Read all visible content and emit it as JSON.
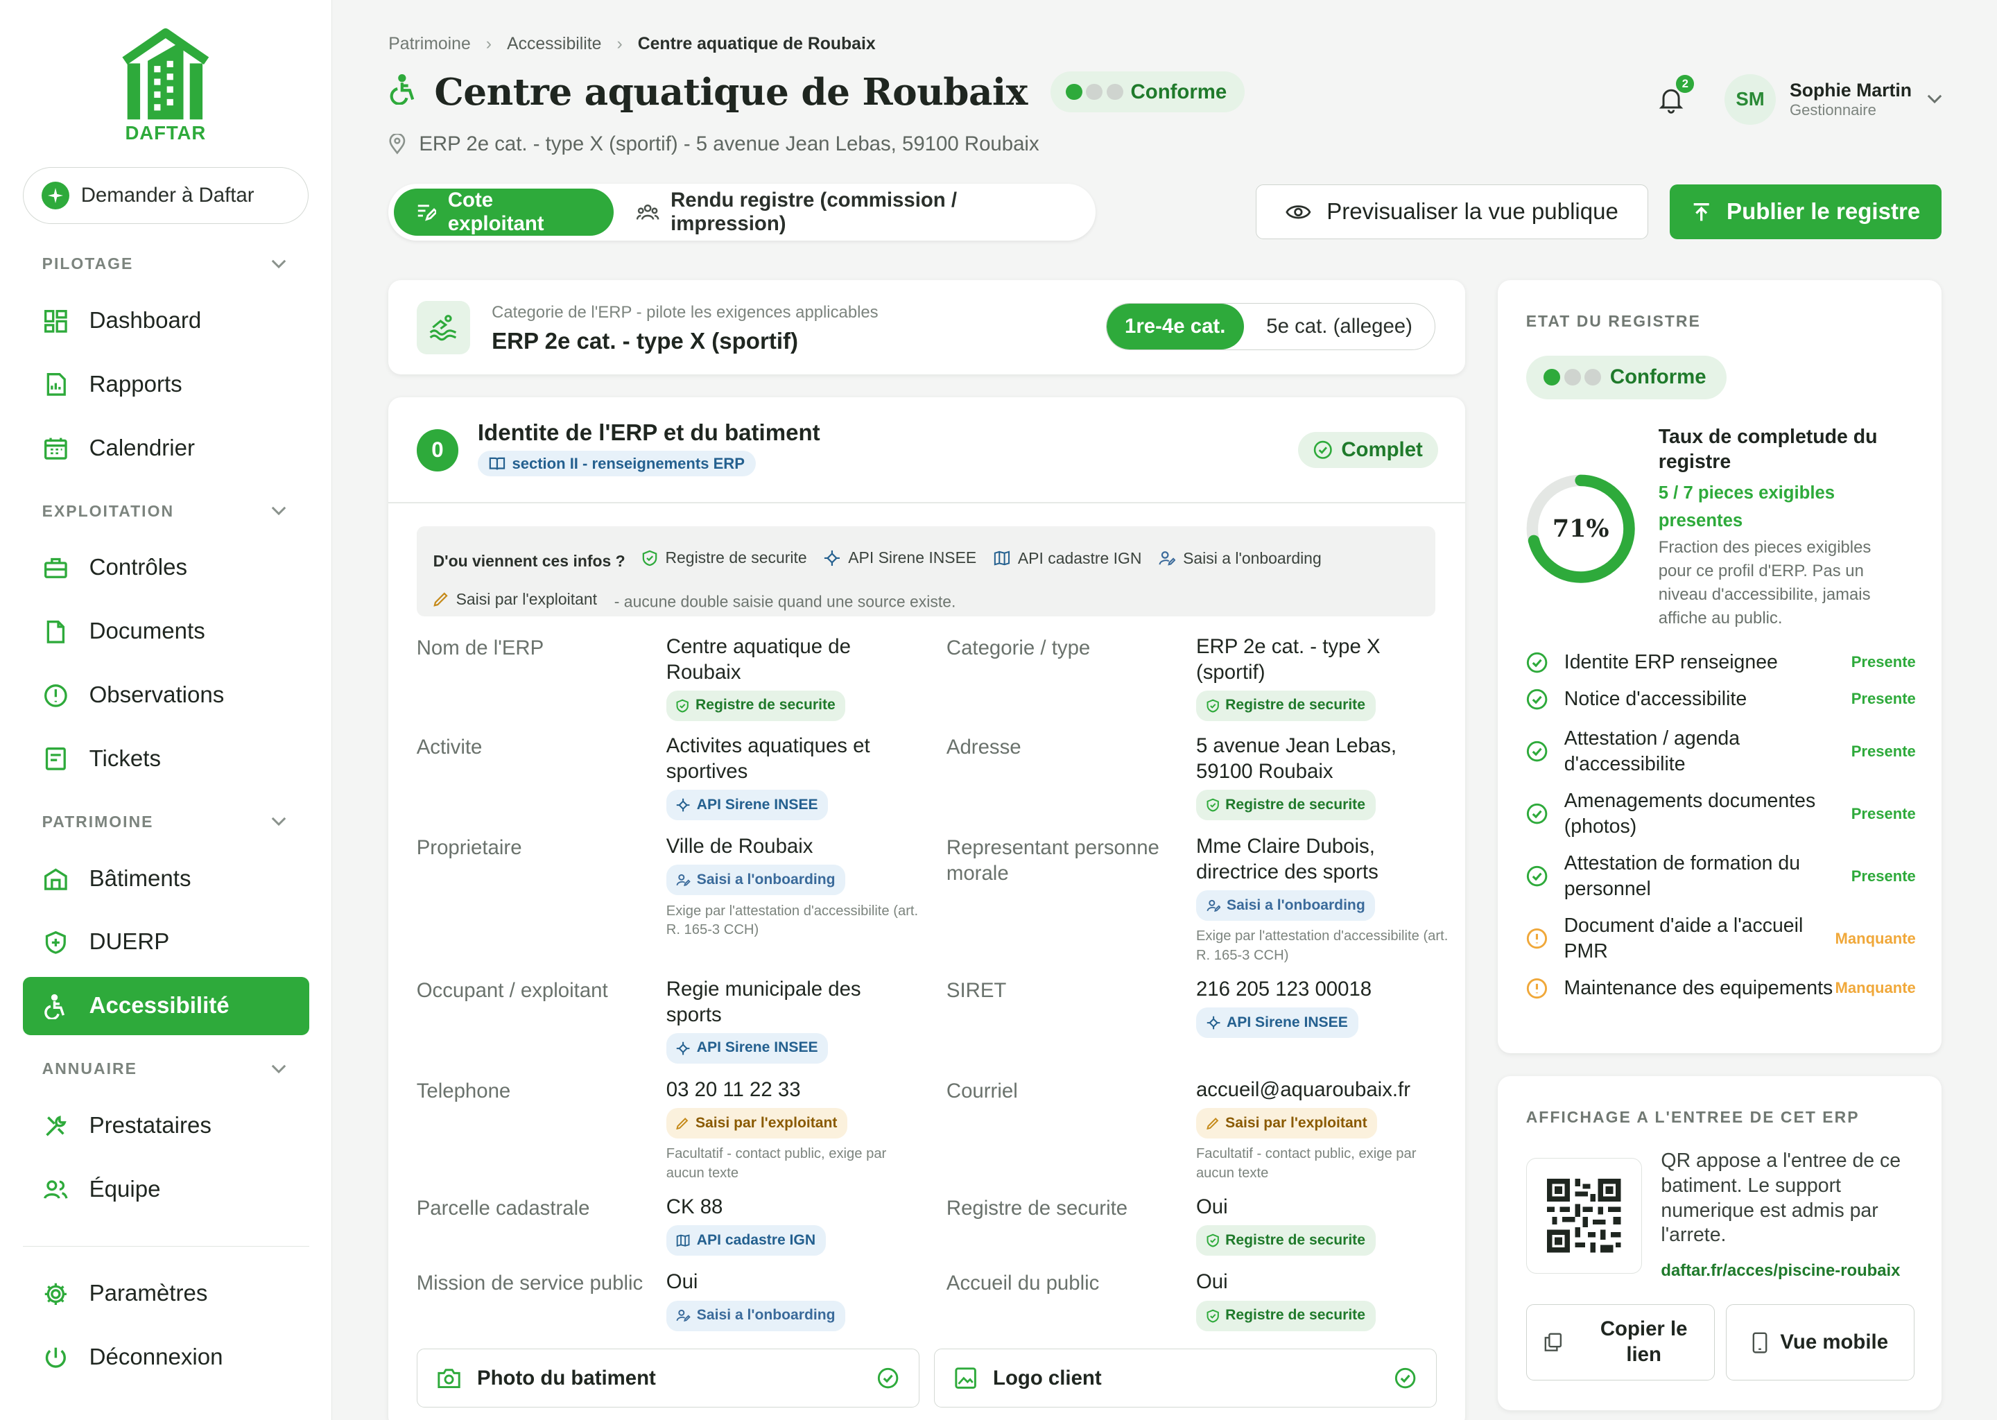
{
  "brand": {
    "name": "DAFTAR",
    "color": "#2eaa3b"
  },
  "sidebar": {
    "ask_label": "Demander à Daftar",
    "sections": {
      "pilotage": "PILOTAGE",
      "exploitation": "EXPLOITATION",
      "patrimoine": "PATRIMOINE",
      "annuaire": "ANNUAIRE"
    },
    "items": {
      "dashboard": "Dashboard",
      "rapports": "Rapports",
      "calendrier": "Calendrier",
      "controles": "Contrôles",
      "documents": "Documents",
      "observations": "Observations",
      "tickets": "Tickets",
      "batiments": "Bâtiments",
      "duerp": "DUERP",
      "accessibilite": "Accessibilité",
      "prestataires": "Prestataires",
      "equipe": "Équipe",
      "parametres": "Paramètres",
      "deconnexion": "Déconnexion"
    }
  },
  "breadcrumb": [
    "Patrimoine",
    "Accessibilite",
    "Centre aquatique de Roubaix"
  ],
  "header": {
    "title": "Centre aquatique de Roubaix",
    "status": "Conforme",
    "subtitle": "ERP 2e cat. - type X (sportif) - 5 avenue Jean Lebas, 59100 Roubaix",
    "notifications": "2",
    "user_initials": "SM",
    "user_name": "Sophie Martin",
    "user_role": "Gestionnaire"
  },
  "view_toggle": {
    "exploitant": "Cote exploitant",
    "registre": "Rendu registre (commission / impression)"
  },
  "actions": {
    "preview": "Previsualiser la vue publique",
    "publish": "Publier le registre"
  },
  "category": {
    "label": "Categorie de l'ERP - pilote les exigences applicables",
    "value": "ERP 2e cat. - type X (sportif)",
    "opt_full": "1re-4e cat.",
    "opt_light": "5e cat. (allegee)"
  },
  "identity": {
    "step": "0",
    "title": "Identite de l'ERP et du batiment",
    "ref": "section II - renseignements ERP",
    "status": "Complet",
    "sources_question": "D'ou viennent ces infos ?",
    "src_registre": "Registre de securite",
    "src_sirene": "API Sirene INSEE",
    "src_cadastre": "API cadastre IGN",
    "src_onboarding": "Saisi a l'onboarding",
    "src_manual": "Saisi par l'exploitant",
    "sources_note": "- aucune double saisie quand une source existe.",
    "fields": {
      "nom_label": "Nom de l'ERP",
      "nom_value": "Centre aquatique de Roubaix",
      "cat_label": "Categorie / type",
      "cat_value": "ERP 2e cat. - type X (sportif)",
      "act_label": "Activite",
      "act_value": "Activites aquatiques et sportives",
      "adr_label": "Adresse",
      "adr_value": "5 avenue Jean Lebas, 59100 Roubaix",
      "prop_label": "Proprietaire",
      "prop_value": "Ville de Roubaix",
      "rep_label": "Representant personne morale",
      "rep_value": "Mme Claire Dubois, directrice des sports",
      "attest_hint": "Exige par l'attestation d'accessibilite (art. R. 165-3 CCH)",
      "occ_label": "Occupant / exploitant",
      "occ_value": "Regie municipale des sports",
      "siret_label": "SIRET",
      "siret_value": "216 205 123 00018",
      "tel_label": "Telephone",
      "tel_value": "03 20 11 22 33",
      "mail_label": "Courriel",
      "mail_value": "accueil@aquaroubaix.fr",
      "optional_hint": "Facultatif - contact public, exige par aucun texte",
      "parc_label": "Parcelle cadastrale",
      "parc_value": "CK 88",
      "regsec_label": "Registre de securite",
      "regsec_value": "Oui",
      "msp_label": "Mission de service public",
      "msp_value": "Oui",
      "accueil_label": "Accueil du public",
      "accueil_value": "Oui"
    },
    "photo_label": "Photo du batiment",
    "logo_label": "Logo client"
  },
  "registry_state": {
    "title": "ETAT DU REGISTRE",
    "status": "Conforme",
    "percent_label": "71%",
    "percent": 71,
    "rate_title": "Taux de completude du registre",
    "rate_count": "5 / 7 pieces exigibles presentes",
    "rate_note": "Fraction des pieces exigibles pour ce profil d'ERP. Pas un niveau d'accessibilite, jamais affiche au public.",
    "items": [
      {
        "label": "Identite ERP renseignee",
        "status": "Presente",
        "ok": true
      },
      {
        "label": "Notice d'accessibilite",
        "status": "Presente",
        "ok": true
      },
      {
        "label": "Attestation / agenda d'accessibilite",
        "status": "Presente",
        "ok": true
      },
      {
        "label": "Amenagements documentes (photos)",
        "status": "Presente",
        "ok": true
      },
      {
        "label": "Attestation de formation du personnel",
        "status": "Presente",
        "ok": true
      },
      {
        "label": "Document d'aide a l'accueil PMR",
        "status": "Manquante",
        "ok": false
      },
      {
        "label": "Maintenance des equipements",
        "status": "Manquante",
        "ok": false
      }
    ]
  },
  "display": {
    "title": "AFFICHAGE A L'ENTREE DE CET ERP",
    "text": "QR appose a l'entree de ce batiment. Le support numerique est admis par l'arrete.",
    "link": "daftar.fr/acces/piscine-roubaix",
    "copy": "Copier le lien",
    "mobile": "Vue mobile"
  },
  "colors": {
    "accent": "#2eaa3b",
    "warning": "#f0a83a",
    "info": "#24608f"
  }
}
